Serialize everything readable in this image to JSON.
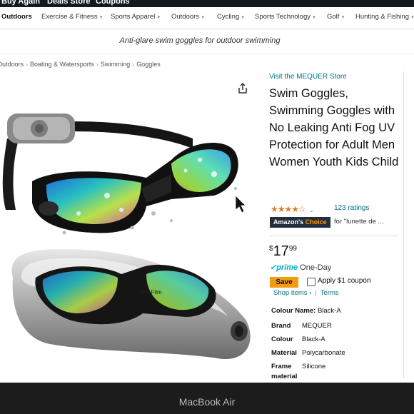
{
  "top_nav": {
    "items": [
      "Buy Again",
      "Deals Store",
      "Coupons"
    ]
  },
  "sub_nav": {
    "items": [
      {
        "label": "Outdoors",
        "caret": false,
        "active": true
      },
      {
        "label": "Exercise & Fitness",
        "caret": true
      },
      {
        "label": "Sports Apparel",
        "caret": true
      },
      {
        "label": "Outdoors",
        "caret": true
      },
      {
        "label": "Cycling",
        "caret": true
      },
      {
        "label": "Sports Technology",
        "caret": true
      },
      {
        "label": "Golf",
        "caret": true
      },
      {
        "label": "Hunting & Fishing",
        "caret": true
      }
    ]
  },
  "banner": {
    "text": "Anti-glare swim goggles for outdoor swimming"
  },
  "breadcrumb": [
    "Outdoors",
    "Boating & Watersports",
    "Swimming",
    "Goggles"
  ],
  "product": {
    "store_link": "Visit the MEQUER Store",
    "title": "Swim Goggles, Swimming Goggles with No Leaking Anti Fog UV Protection for Adult Men Women Youth Kids Child",
    "stars": "★★★★☆",
    "rating_count": "123 ratings",
    "choice_badge": {
      "prefix": "Amazon's",
      "highlight": "Choice"
    },
    "choice_for": "for \"lunette de ...",
    "price": {
      "currency": "$",
      "whole": "17",
      "fraction": "99"
    },
    "prime": {
      "label": "✓prime",
      "delivery": "One-Day"
    },
    "save_badge": "Save",
    "coupon": "Apply $1 coupon",
    "shop_items": "Shop items ›",
    "terms": "Terms",
    "colour_name": {
      "label": "Colour Name:",
      "value": "Black-A"
    },
    "specs": [
      {
        "key": "Brand",
        "value": "MEQUER"
      },
      {
        "key": "Colour",
        "value": "Black-A"
      },
      {
        "key": "Material",
        "value": "Polycarbonate"
      },
      {
        "key": "Frame",
        "value": "Silicone"
      },
      {
        "key": "material",
        "value": ""
      }
    ],
    "case_label": "Anti-Film"
  },
  "device_label": "MacBook Air",
  "colors": {
    "nav_dark": "#131921",
    "link": "#007185",
    "price_text": "#0f1111",
    "prime_blue": "#00a8e1",
    "save_orange": "#f39c12",
    "choice_bg": "#232f3e",
    "star": "#de7921"
  }
}
